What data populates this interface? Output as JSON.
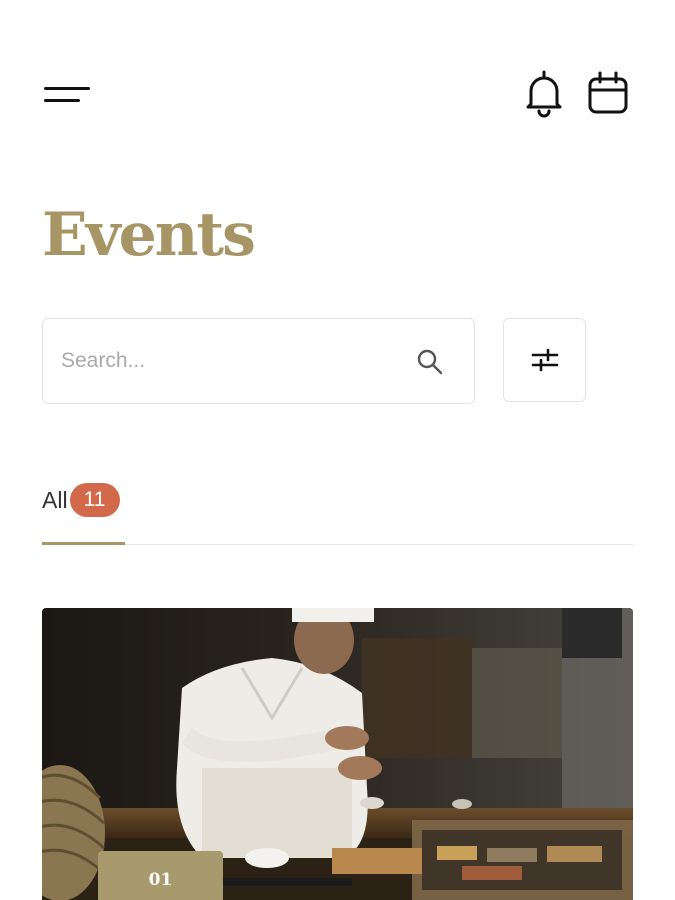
{
  "header": {
    "menu_icon": "hamburger-menu-icon",
    "notification_icon": "bell-icon",
    "calendar_icon": "calendar-icon"
  },
  "page": {
    "title": "Events"
  },
  "search": {
    "placeholder": "Search...",
    "value": "",
    "icon": "search-icon"
  },
  "filter": {
    "icon": "sliders-icon"
  },
  "tabs": [
    {
      "label": "All",
      "count": "11",
      "active": true
    }
  ],
  "events": [
    {
      "number": "01",
      "image": "photo of chef preparing sushi at kitchen counter"
    }
  ],
  "colors": {
    "accent": "#a89566",
    "badge": "#d2694a",
    "tag": "#a99a6d"
  }
}
